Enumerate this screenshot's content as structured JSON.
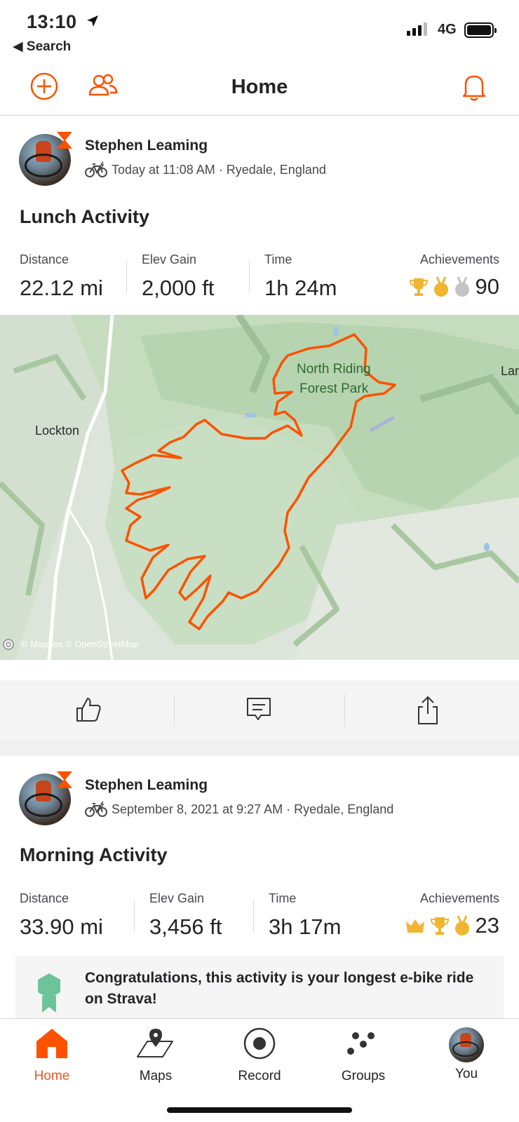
{
  "status_bar": {
    "time": "13:10",
    "back_label": "Search",
    "network": "4G"
  },
  "header": {
    "title": "Home"
  },
  "feed": [
    {
      "athlete": "Stephen Leaming",
      "meta": "Today at 11:08 AM · Ryedale, England",
      "title": "Lunch Activity",
      "stats": [
        {
          "label": "Distance",
          "value": "22.12 mi"
        },
        {
          "label": "Elev Gain",
          "value": "2,000 ft"
        },
        {
          "label": "Time",
          "value": "1h 24m"
        }
      ],
      "achievements": {
        "label": "Achievements",
        "count": "90",
        "icons": [
          "trophy-icon",
          "gold-medal-icon",
          "silver-medal-icon"
        ]
      },
      "map": {
        "labels": {
          "lockton": "Lockton",
          "park_line1": "North Riding",
          "park_line2": "Forest Park",
          "edge": "Lan"
        },
        "attribution": "© Mapbox © OpenStreetMap",
        "route_color": "#fc5200"
      }
    },
    {
      "athlete": "Stephen Leaming",
      "meta": "September 8, 2021 at 9:27 AM · Ryedale, England",
      "title": "Morning Activity",
      "stats": [
        {
          "label": "Distance",
          "value": "33.90 mi"
        },
        {
          "label": "Elev Gain",
          "value": "3,456 ft"
        },
        {
          "label": "Time",
          "value": "3h 17m"
        }
      ],
      "achievements": {
        "label": "Achievements",
        "count": "23",
        "icons": [
          "crown-icon",
          "trophy-icon",
          "gold-medal-icon"
        ]
      },
      "congrats": "Congratulations, this activity is your longest e-bike ride on Strava!"
    }
  ],
  "tabs": [
    {
      "label": "Home",
      "icon": "home-icon",
      "active": true
    },
    {
      "label": "Maps",
      "icon": "map-icon"
    },
    {
      "label": "Record",
      "icon": "record-icon"
    },
    {
      "label": "Groups",
      "icon": "groups-icon"
    },
    {
      "label": "You",
      "icon": "avatar"
    }
  ],
  "colors": {
    "brand": "#fc5200",
    "gold": "#f2b431",
    "silver": "#c4c4c4"
  }
}
